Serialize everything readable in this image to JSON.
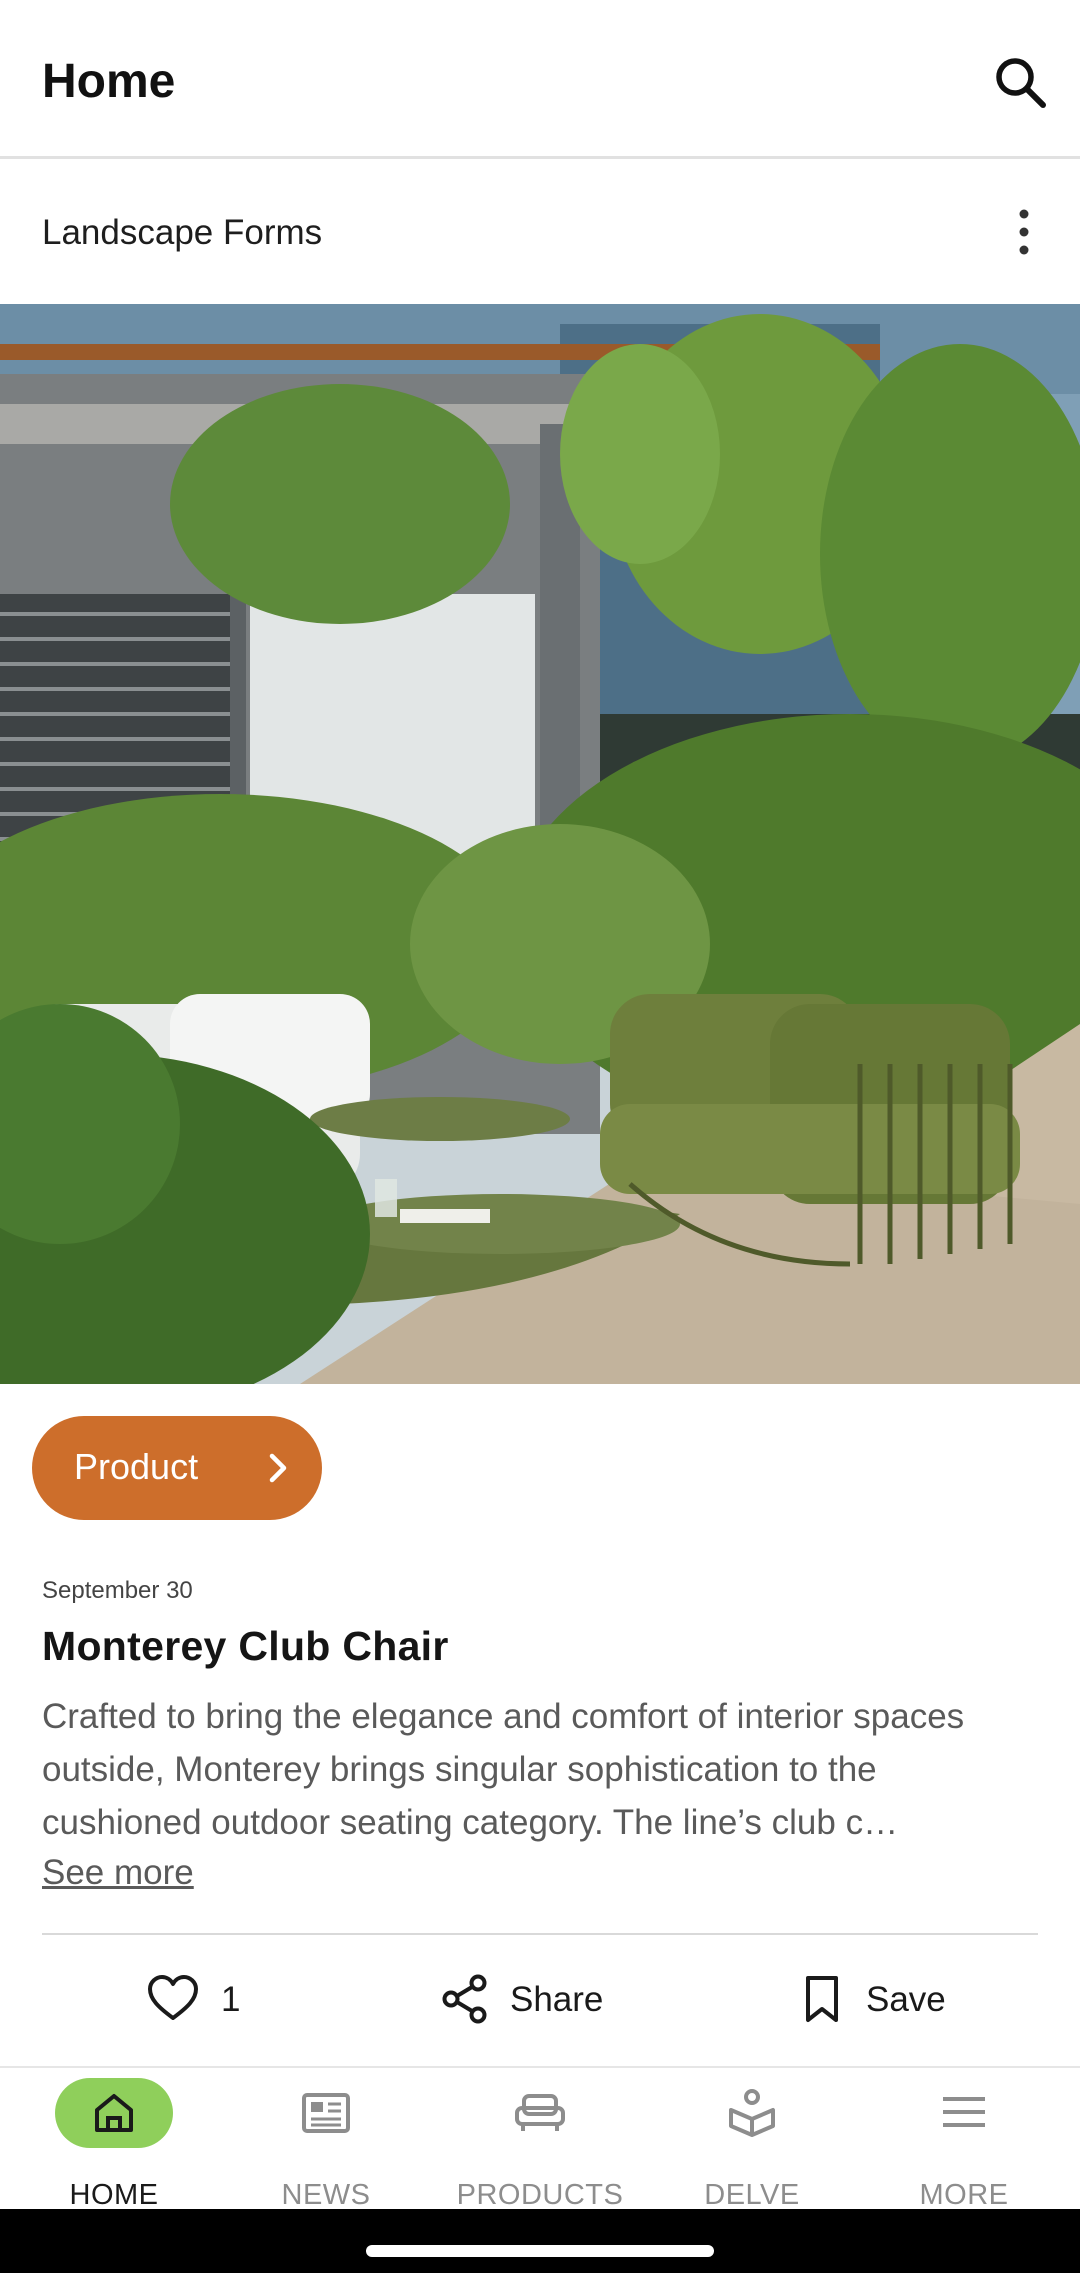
{
  "header": {
    "title": "Home"
  },
  "source": {
    "name": "Landscape Forms"
  },
  "card": {
    "tag": "Product",
    "date": "September 30",
    "title": "Monterey Club Chair",
    "description": "Crafted to bring the elegance and comfort of interior spaces outside, Monterey brings singular sophistication to the cushioned outdoor seating category. The line’s club c…",
    "see_more": "See more",
    "actions": {
      "like_count": "1",
      "share": "Share",
      "save": "Save"
    }
  },
  "bottom_nav": {
    "items": [
      {
        "label": "HOME",
        "icon": "home-icon",
        "active": true
      },
      {
        "label": "NEWS",
        "icon": "news-icon",
        "active": false
      },
      {
        "label": "PRODUCTS",
        "icon": "products-icon",
        "active": false
      },
      {
        "label": "DELVE",
        "icon": "delve-icon",
        "active": false
      },
      {
        "label": "MORE",
        "icon": "menu-icon",
        "active": false
      }
    ]
  },
  "colors": {
    "accent": "#cd6e2b",
    "active_nav": "#8fcf5b"
  }
}
